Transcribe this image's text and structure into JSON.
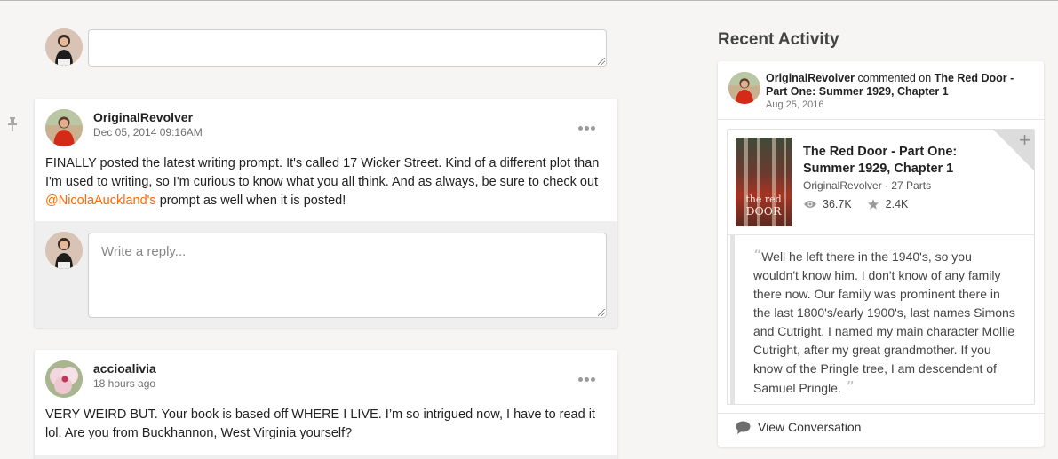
{
  "composer": {
    "placeholder": ""
  },
  "post1": {
    "author": "OriginalRevolver",
    "timestamp": "Dec 05, 2014 09:16AM",
    "body_before": "FINALLY posted the latest writing prompt. It's called 17 Wicker Street. Kind of a different plot than I'm used to writing, so I'm curious to know what you all think. And as always, be sure to check out ",
    "mention": "@NicolaAuckland's",
    "body_after": " prompt as well when it is posted!",
    "reply_placeholder": "Write a reply..."
  },
  "post2": {
    "author": "accioalivia",
    "timestamp": "18 hours ago",
    "body": "VERY WEIRD BUT. Your book is based off WHERE I LIVE. I’m so intrigued now, I have to read it lol. Are you from Buckhannon, West Virginia yourself?"
  },
  "recent_activity": {
    "title": "Recent Activity",
    "item": {
      "actor": "OriginalRevolver",
      "action": " commented on ",
      "target": "The Red Door - Part One: Summer 1929, Chapter 1",
      "date": "Aug 25, 2016",
      "story": {
        "title": "The Red Door - Part One: Summer 1929, Chapter 1",
        "author": "OriginalRevolver",
        "parts": "27 Parts",
        "cover_text_line1": "the red",
        "cover_text_line2": "DOOR",
        "reads": "36.7K",
        "votes": "2.4K",
        "add_icon": "+"
      },
      "quote": "Well he left there in the 1940's, so you wouldn't know him. I don't know of any family there now. Our family was prominent there in the last 1800's/early 1900's, last names Simons and Cutright. I named my main character Mollie Cutright, after my great grandmother. If you know of the Pringle tree, I am descendent of Samuel Pringle.",
      "view_conversation": "View Conversation"
    }
  },
  "colors": {
    "mention": "#ff6a00",
    "background": "#f6f5f3"
  },
  "icons": [
    "pin-icon",
    "more-options-icon",
    "eye-icon",
    "star-icon",
    "plus-icon",
    "speech-bubble-icon"
  ]
}
